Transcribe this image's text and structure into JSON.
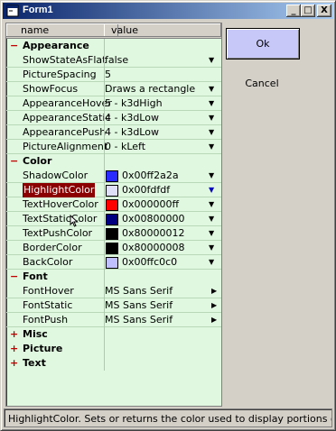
{
  "window": {
    "title": "Form1",
    "minimize": "_",
    "maximize": "□",
    "close": "X"
  },
  "grid": {
    "header": {
      "name": "name",
      "value": "value"
    },
    "rows": [
      {
        "kind": "cat",
        "sym": "−",
        "name": "Appearance"
      },
      {
        "kind": "prop",
        "name": "ShowStateAsFlat",
        "value": "false",
        "control": "dropdown"
      },
      {
        "kind": "prop",
        "name": "PictureSpacing",
        "value": "5",
        "control": "none"
      },
      {
        "kind": "prop",
        "name": "ShowFocus",
        "value": "Draws a rectangle",
        "control": "dropdown"
      },
      {
        "kind": "prop",
        "name": "AppearanceHover",
        "value": "5 - k3dHigh",
        "control": "dropdown"
      },
      {
        "kind": "prop",
        "name": "AppearanceStatic",
        "value": "4 - k3dLow",
        "control": "dropdown"
      },
      {
        "kind": "prop",
        "name": "AppearancePush",
        "value": "4 - k3dLow",
        "control": "dropdown"
      },
      {
        "kind": "prop",
        "name": "PictureAlignment",
        "value": "0 - kLeft",
        "control": "dropdown"
      },
      {
        "kind": "cat",
        "sym": "−",
        "name": "Color"
      },
      {
        "kind": "color",
        "name": "ShadowColor",
        "value": "0x00ff2a2a",
        "swatch": "#2a2aff",
        "control": "dropdown"
      },
      {
        "kind": "color",
        "name": "HighlightColor",
        "value": "0x00fdfdf",
        "swatch": "#dfdff8",
        "control": "dropdown",
        "selected": true
      },
      {
        "kind": "color",
        "name": "TextHoverColor",
        "value": "0x000000ff",
        "swatch": "#ff0000",
        "control": "dropdown"
      },
      {
        "kind": "color",
        "name": "TextStaticColor",
        "value": "0x00800000",
        "swatch": "#000080",
        "control": "dropdown"
      },
      {
        "kind": "color",
        "name": "TextPushColor",
        "value": "0x80000012",
        "swatch": "#000000",
        "control": "dropdown"
      },
      {
        "kind": "color",
        "name": "BorderColor",
        "value": "0x80000008",
        "swatch": "#000000",
        "control": "dropdown"
      },
      {
        "kind": "color",
        "name": "BackColor",
        "value": "0x00ffc0c0",
        "swatch": "#c0c0ff",
        "control": "dropdown"
      },
      {
        "kind": "cat",
        "sym": "−",
        "name": "Font"
      },
      {
        "kind": "prop",
        "name": "FontHover",
        "value": "MS Sans Serif",
        "control": "arrow"
      },
      {
        "kind": "prop",
        "name": "FontStatic",
        "value": "MS Sans Serif",
        "control": "arrow"
      },
      {
        "kind": "prop",
        "name": "FontPush",
        "value": "MS Sans Serif",
        "control": "arrow"
      },
      {
        "kind": "cat",
        "sym": "+",
        "name": "Misc"
      },
      {
        "kind": "cat",
        "sym": "+",
        "name": "Picture"
      },
      {
        "kind": "cat",
        "sym": "+",
        "name": "Text"
      }
    ]
  },
  "buttons": {
    "ok": "Ok",
    "cancel": "Cancel"
  },
  "status": "HighlightColor. Sets or returns the color used to display portions of the bu",
  "colors": {
    "titlebar_start": "#0a246a",
    "grid_bg": "#dff8df",
    "selected_bg": "#8b0000",
    "ok_bg": "#c8c8f8"
  },
  "icons": {
    "app": "form-icon",
    "dropdown": "dropdown-arrow-icon",
    "submenu": "right-arrow-icon"
  }
}
